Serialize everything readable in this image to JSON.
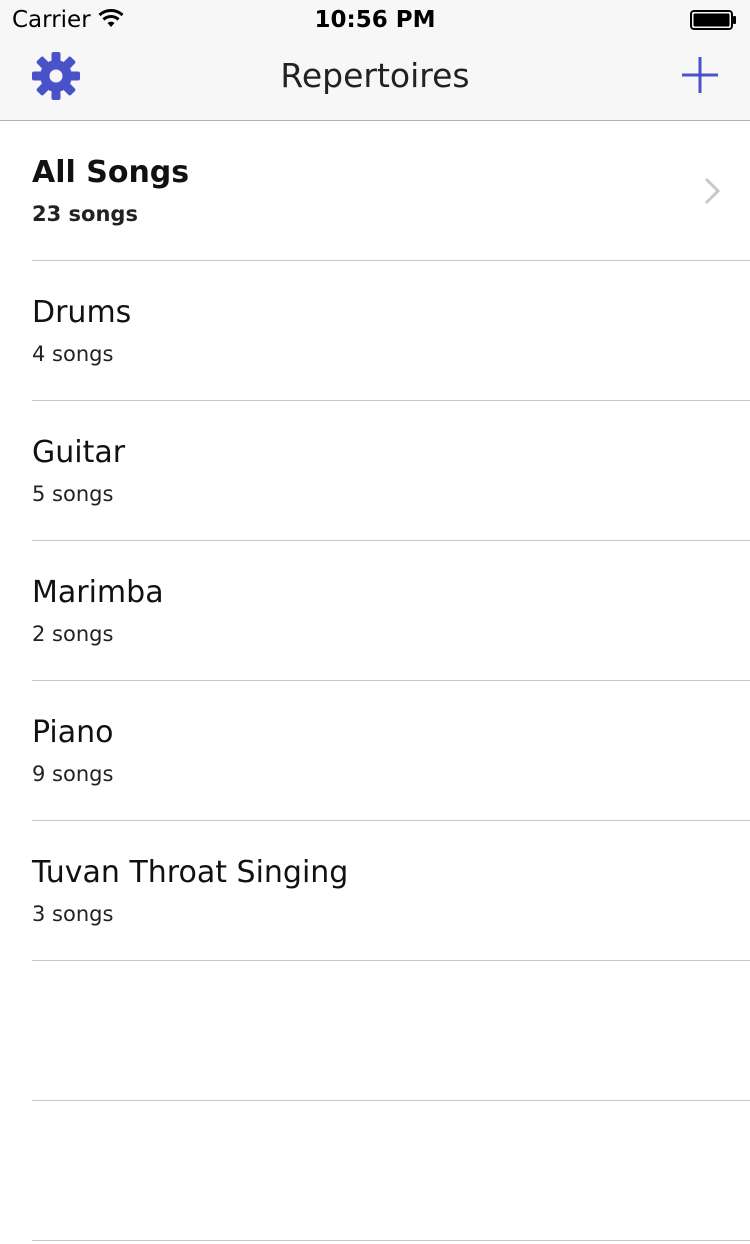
{
  "status_bar": {
    "carrier": "Carrier",
    "time": "10:56 PM"
  },
  "nav": {
    "title": "Repertoires",
    "settings_icon": "gear-icon",
    "add_icon": "plus-icon",
    "accent_color": "#4a52c9"
  },
  "repertoires": [
    {
      "name": "All Songs",
      "count": "23 songs"
    },
    {
      "name": "Drums",
      "count": "4 songs"
    },
    {
      "name": "Guitar",
      "count": "5 songs"
    },
    {
      "name": "Marimba",
      "count": "2 songs"
    },
    {
      "name": "Piano",
      "count": "9 songs"
    },
    {
      "name": "Tuvan Throat Singing",
      "count": "3 songs"
    }
  ]
}
